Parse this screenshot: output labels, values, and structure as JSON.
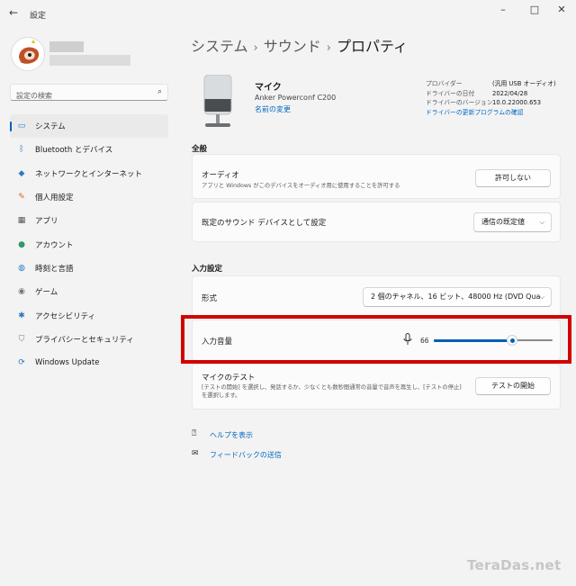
{
  "window": {
    "title": "設定",
    "back_icon": "back-arrow-icon",
    "controls": [
      "–",
      "□",
      "✕"
    ]
  },
  "search": {
    "placeholder": "設定の検索",
    "icon": "search-icon"
  },
  "sidebar": {
    "items": [
      {
        "label": "システム",
        "icon": "system-icon",
        "glyph": "▭",
        "color": "#2b79c2",
        "active": true
      },
      {
        "label": "Bluetooth とデバイス",
        "icon": "bluetooth-icon",
        "glyph": "ᛒ",
        "color": "#2b79c2"
      },
      {
        "label": "ネットワークとインターネット",
        "icon": "wifi-icon",
        "glyph": "◆",
        "color": "#2b79c2"
      },
      {
        "label": "個人用設定",
        "icon": "brush-icon",
        "glyph": "✎",
        "color": "#d06a28"
      },
      {
        "label": "アプリ",
        "icon": "apps-icon",
        "glyph": "▦",
        "color": "#555555"
      },
      {
        "label": "アカウント",
        "icon": "account-icon",
        "glyph": "●",
        "color": "#2e9a6a"
      },
      {
        "label": "時刻と言語",
        "icon": "globe-icon",
        "glyph": "◍",
        "color": "#2b79c2"
      },
      {
        "label": "ゲーム",
        "icon": "gamepad-icon",
        "glyph": "◉",
        "color": "#777777"
      },
      {
        "label": "アクセシビリティ",
        "icon": "accessibility-icon",
        "glyph": "✱",
        "color": "#2b79c2"
      },
      {
        "label": "プライバシーとセキュリティ",
        "icon": "shield-icon",
        "glyph": "⛉",
        "color": "#777777"
      },
      {
        "label": "Windows Update",
        "icon": "windows-update-icon",
        "glyph": "⟳",
        "color": "#2b79c2"
      }
    ]
  },
  "breadcrumb": {
    "items": [
      "システム",
      "サウンド"
    ],
    "current": "プロパティ",
    "separator": "›"
  },
  "device": {
    "name": "マイク",
    "model": "Anker Powerconf C200",
    "rename_label": "名前の変更",
    "props": [
      {
        "key": "プロバイダー",
        "value": "(汎用 USB オーディオ)"
      },
      {
        "key": "ドライバーの日付",
        "value": "2022/04/28"
      },
      {
        "key": "ドライバーのバージョン",
        "value": "10.0.22000.653"
      }
    ],
    "driver_update_link": "ドライバーの更新プログラムの確認"
  },
  "general": {
    "title": "全般",
    "audio_label": "オーディオ",
    "audio_desc": "アプリと Windows がこのデバイスをオーディオ用に使用することを許可する",
    "audio_button": "許可しない",
    "default_label": "既定のサウンド デバイスとして設定",
    "default_value": "通信の既定値"
  },
  "input": {
    "title": "入力設定",
    "format_label": "形式",
    "format_value": "2 個のチャネル、16 ビット、48000 Hz (DVD Qua",
    "volume_label": "入力音量",
    "volume_value": "66",
    "volume_fraction": 0.66,
    "test_label": "マイクのテスト",
    "test_desc": "[テストの開始] を選択し、発話するか、少なくとも数秒間通常の音量で音声を再生し、[テストの停止] を選択します。",
    "test_button": "テストの開始"
  },
  "help": {
    "help_label": "ヘルプを表示",
    "feedback_label": "フィードバックの送信"
  },
  "watermark": "TeraDas.net",
  "colors": {
    "accent": "#005fb8",
    "link": "#0067c0",
    "highlight": "#d30000"
  }
}
